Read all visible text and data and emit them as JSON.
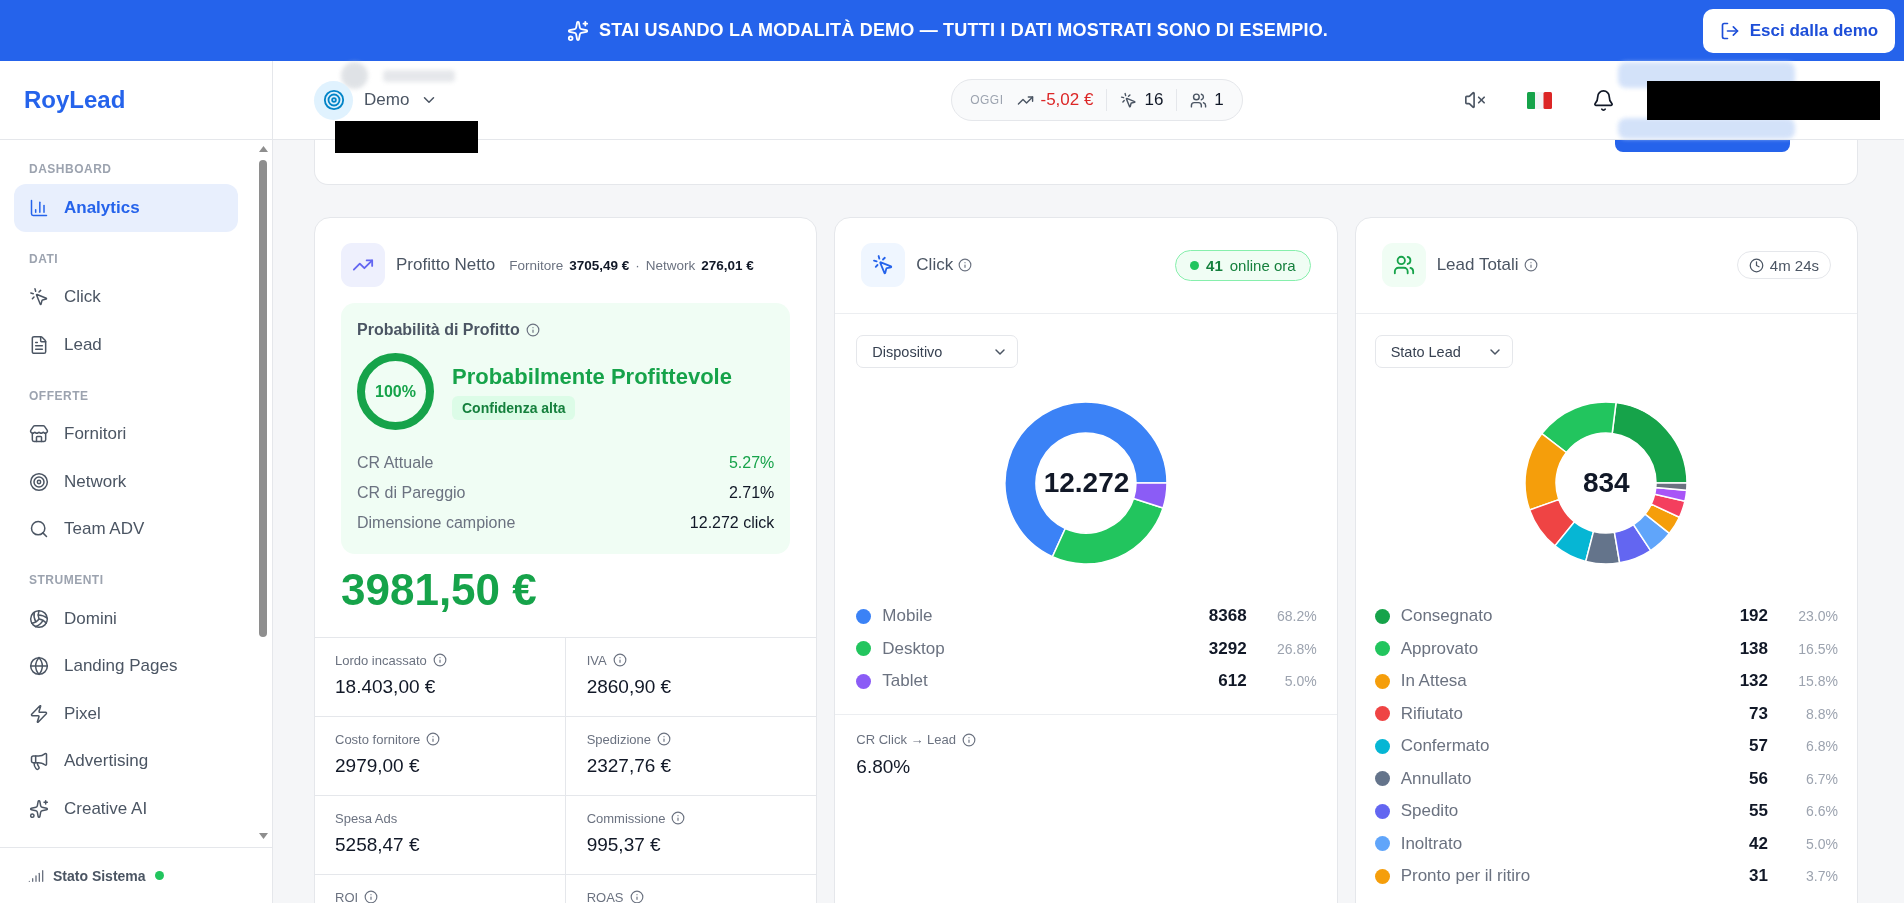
{
  "banner": {
    "text": "STAI USANDO LA MODALITÀ DEMO — TUTTI I DATI MOSTRATI SONO DI ESEMPIO.",
    "button": "Esci dalla demo"
  },
  "sidebar": {
    "logo": "RoyLead",
    "sections": [
      {
        "label": "DASHBOARD",
        "items": [
          {
            "label": "Analytics",
            "selected": true
          }
        ]
      },
      {
        "label": "DATI",
        "items": [
          {
            "label": "Click",
            "selected": false
          },
          {
            "label": "Lead",
            "selected": false
          }
        ]
      },
      {
        "label": "OFFERTE",
        "items": [
          {
            "label": "Fornitori",
            "selected": false
          },
          {
            "label": "Network",
            "selected": false
          },
          {
            "label": "Team ADV",
            "selected": false
          }
        ]
      },
      {
        "label": "STRUMENTI",
        "items": [
          {
            "label": "Domini",
            "selected": false
          },
          {
            "label": "Landing Pages",
            "selected": false
          },
          {
            "label": "Pixel",
            "selected": false
          },
          {
            "label": "Advertising",
            "selected": false
          },
          {
            "label": "Creative AI",
            "selected": false
          }
        ]
      }
    ],
    "footer": {
      "label": "Stato Sistema",
      "online": true
    }
  },
  "header": {
    "workspace": "Demo",
    "today": {
      "label": "OGGI",
      "profit": "-5,02 €",
      "profit_negative": true,
      "clicks": "16",
      "users": "1"
    },
    "muted": true
  },
  "profit_card": {
    "title": "Profitto Netto",
    "supplier_label": "Fornitore",
    "supplier_value": "3705,49 €",
    "separator": "·",
    "network_label": "Network",
    "network_value": "276,01 €",
    "probability": {
      "title": "Probabilità di Profitto",
      "level": 1.0,
      "percent": "100%",
      "verdict": "Probabilmente Profittevole",
      "confidence": "Confidenza alta",
      "rows": [
        {
          "label": "CR Attuale",
          "value": "5.27%",
          "highlight": true
        },
        {
          "label": "CR di Pareggio",
          "value": "2.71%",
          "highlight": false
        },
        {
          "label": "Dimensione campione",
          "value": "12.272 click",
          "highlight": false
        }
      ]
    },
    "total": "3981,50 €",
    "metrics": [
      {
        "label": "Lordo incassato",
        "value": "18.403,00 €",
        "info": true
      },
      {
        "label": "IVA",
        "value": "2860,90 €",
        "info": true
      },
      {
        "label": "Costo fornitore",
        "value": "2979,00 €",
        "info": true
      },
      {
        "label": "Spedizione",
        "value": "2327,76 €",
        "info": true
      },
      {
        "label": "Spesa Ads",
        "value": "5258,47 €",
        "info": false
      },
      {
        "label": "Commissione",
        "value": "995,37 €",
        "info": true
      },
      {
        "label": "ROI",
        "info": true
      },
      {
        "label": "ROAS",
        "info": true
      }
    ]
  },
  "click_card": {
    "title": "Click",
    "online": {
      "count": "41",
      "label": "online ora"
    },
    "filter": "Dispositivo",
    "total": "12.272",
    "chart_data": {
      "type": "donut",
      "categories": [
        "Mobile",
        "Desktop",
        "Tablet"
      ],
      "values": [
        68.2,
        26.8,
        5.0
      ],
      "colors": [
        "#3b82f6",
        "#22c55e",
        "#8b5cf6"
      ]
    },
    "legend": [
      {
        "count": "8368",
        "share": "68.2%"
      },
      {
        "count": "3292",
        "share": "26.8%"
      },
      {
        "count": "612",
        "share": "5.0%"
      }
    ],
    "cr": {
      "label": "CR Click → Lead",
      "value": "6.80%"
    }
  },
  "lead_card": {
    "title": "Lead Totali",
    "timer": "4m 24s",
    "filter": "Stato Lead",
    "total": "834",
    "legend": [
      {
        "label": "Consegnato",
        "count": "192",
        "share": "23.0%",
        "color": "#16a34a"
      },
      {
        "label": "Approvato",
        "count": "138",
        "share": "16.5%",
        "color": "#22c55e"
      },
      {
        "label": "In Attesa",
        "count": "132",
        "share": "15.8%",
        "color": "#f59e0b"
      },
      {
        "label": "Rifiutato",
        "count": "73",
        "share": "8.8%",
        "color": "#ef4444"
      },
      {
        "label": "Confermato",
        "count": "57",
        "share": "6.8%",
        "color": "#06b6d4"
      },
      {
        "label": "Annullato",
        "count": "56",
        "share": "6.7%",
        "color": "#64748b"
      },
      {
        "label": "Spedito",
        "count": "55",
        "share": "6.6%",
        "color": "#6366f1"
      },
      {
        "label": "Inoltrato",
        "count": "42",
        "share": "5.0%",
        "color": "#60a5fa"
      },
      {
        "label": "Pronto per il ritiro",
        "count": "31",
        "share": "3.7%",
        "color": "#f59e0b"
      }
    ]
  }
}
